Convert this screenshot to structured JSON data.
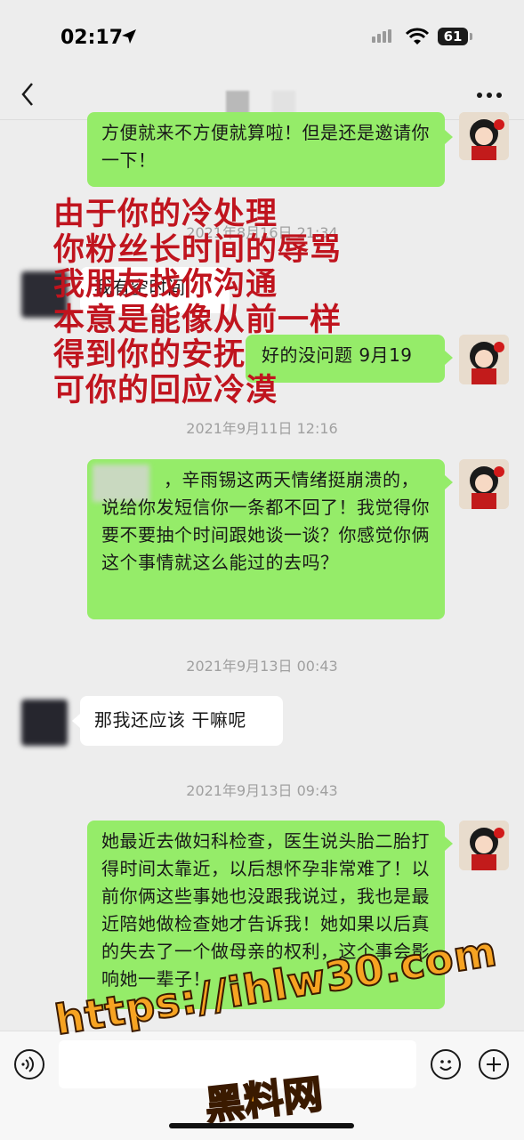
{
  "status_bar": {
    "time": "02:17",
    "battery": "61"
  },
  "chat": {
    "messages": [
      {
        "text": "方便就来不方便就算啦！但是还是邀请你一下！"
      },
      {
        "timestamp": "2021年8月16日 21:34"
      },
      {
        "text": "我有空时间"
      },
      {
        "text": "好的没问题 9月19"
      },
      {
        "timestamp": "2021年9月11日 12:16"
      },
      {
        "text": "，辛雨锡这两天情绪挺崩溃的，说给你发短信你一条都不回了！我觉得你要不要抽个时间跟她谈一谈？你感觉你俩这个事情就这么能过的去吗？"
      },
      {
        "timestamp": "2021年9月13日 00:43"
      },
      {
        "text": "那我还应该 干嘛呢"
      },
      {
        "timestamp": "2021年9月13日 09:43"
      },
      {
        "text": "她最近去做妇科检查，医生说头胎二胎打得时间太靠近，以后想怀孕非常难了！以前你俩这些事她也没跟我说过，我也是最近陪她做检查她才告诉我！她如果以后真的失去了一个做母亲的权利，这个事会影响她一辈子！"
      }
    ]
  },
  "overlay_text": [
    "由于你的冷处理",
    "你粉丝长时间的辱骂",
    "我朋友找你沟通",
    "本意是能像从前一样",
    "得到你的安抚",
    "可你的回应冷漠"
  ],
  "watermark": {
    "url": "https://ihlw30.com",
    "name": "黑料网"
  },
  "colors": {
    "outgoing_bubble": "#95ec69",
    "incoming_bubble": "#ffffff",
    "overlay_text": "#c0141e",
    "watermark": "#f6a322"
  }
}
